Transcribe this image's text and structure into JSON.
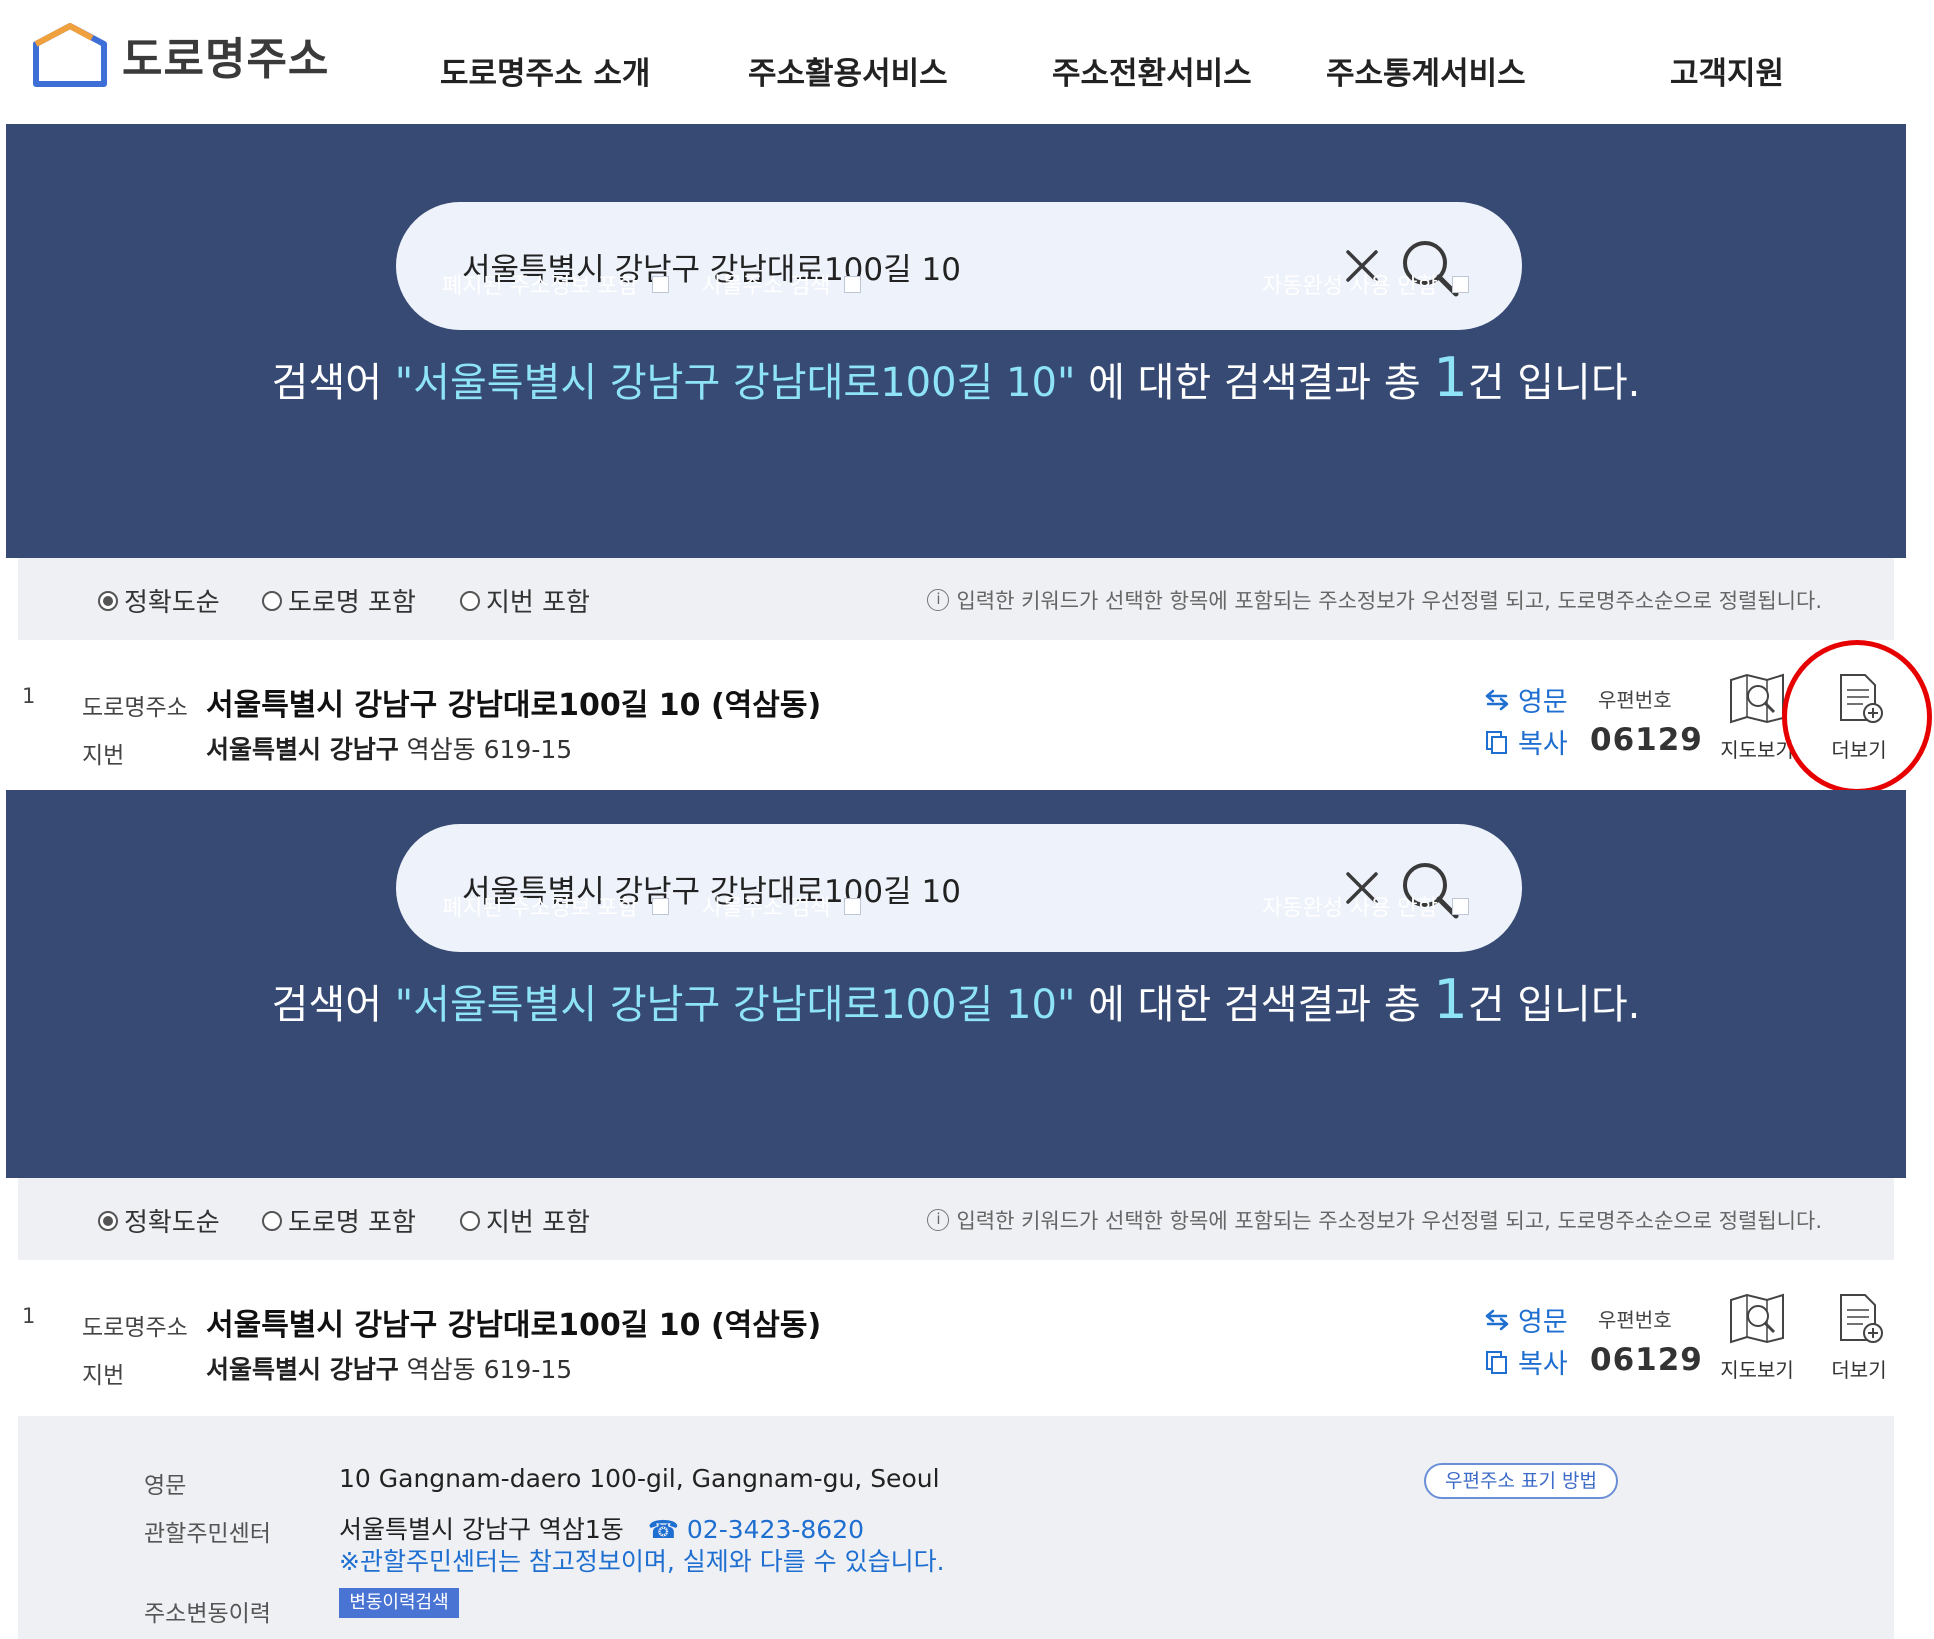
{
  "header": {
    "logo_text": "도로명주소",
    "nav": [
      "도로명주소 소개",
      "주소활용서비스",
      "주소전환서비스",
      "주소통계서비스",
      "고객지원"
    ]
  },
  "search": {
    "query": "서울특별시 강남구 강남대로100길 10",
    "options": {
      "include_abolished": "폐지된 주소정보 포함",
      "thing_address": "사물주소 검색",
      "autocomplete_off": "자동완성 사용 안함"
    },
    "result_prefix": "검색어 ",
    "result_keyword": "\"서울특별시 강남구 강남대로100길 10\"",
    "result_middle": " 에 대한 검색결과 총 ",
    "result_count": "1",
    "result_suffix": "건 입니다."
  },
  "sort": {
    "options": [
      "정확도순",
      "도로명 포함",
      "지번 포함"
    ],
    "selected": "정확도순",
    "info_icon": "i",
    "info": "입력한 키워드가 선택한 항목에 포함되는 주소정보가 우선정렬 되고, 도로명주소순으로 정렬됩니다."
  },
  "result": {
    "no": "1",
    "road_label": "도로명주소",
    "road_address": "서울특별시 강남구 강남대로100길 10 (역삼동)",
    "jibun_label": "지번",
    "jibun_bold": "서울특별시 강남구",
    "jibun_rest": " 역삼동 619-15",
    "english_btn": "영문",
    "copy_btn": "복사",
    "zip_label": "우편번호",
    "zip": "06129",
    "map_btn": "지도보기",
    "more_btn": "더보기"
  },
  "detail": {
    "english_label": "영문",
    "english_value": "10 Gangnam-daero 100-gil, Gangnam-gu, Seoul",
    "zip_method_btn": "우편주소 표기 방법",
    "center_label": "관할주민센터",
    "center_value": "서울특별시 강남구 역삼1동",
    "center_phone": "☎ 02-3423-8620",
    "center_note": "※관할주민센터는 참고정보이며, 실제와 다를 수 있습니다.",
    "history_label": "주소변동이력",
    "history_btn": "변동이력검색"
  },
  "colors": {
    "band": "#364a74",
    "accent_text": "#8ee3f4",
    "link_blue": "#1f6fd1",
    "highlight": "#e60000"
  }
}
